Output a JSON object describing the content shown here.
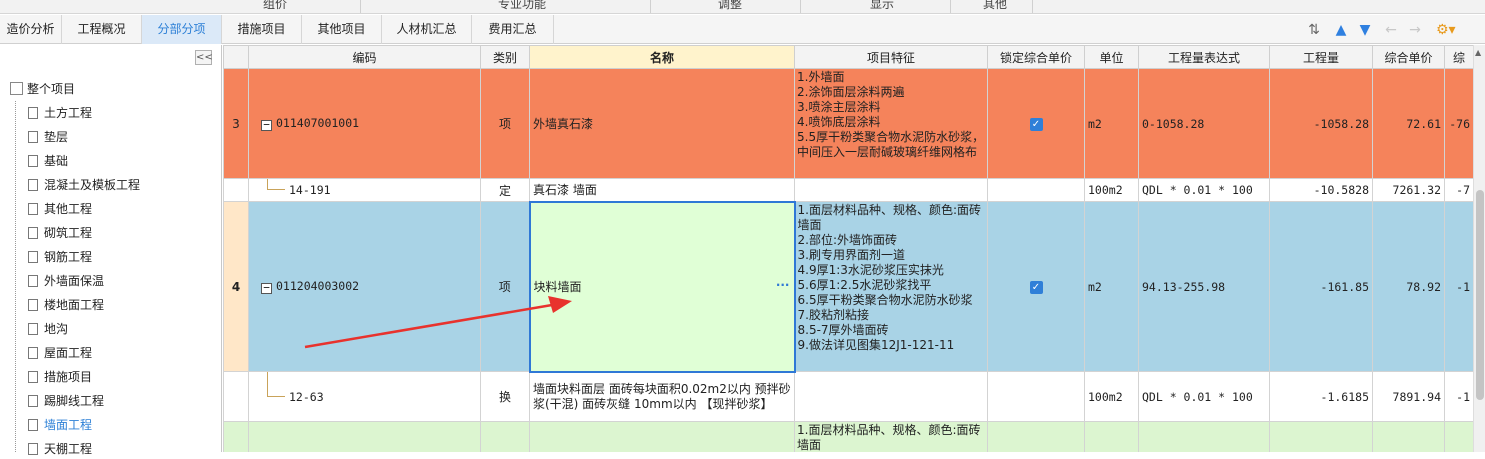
{
  "ribbon_groups": [
    "组价",
    "专业功能",
    "调整",
    "显示",
    "其他"
  ],
  "tabs": [
    {
      "label": "造价分析",
      "active": false
    },
    {
      "label": "工程概况",
      "active": false
    },
    {
      "label": "分部分项",
      "active": true
    },
    {
      "label": "措施项目",
      "active": false
    },
    {
      "label": "其他项目",
      "active": false
    },
    {
      "label": "人材机汇总",
      "active": false
    },
    {
      "label": "费用汇总",
      "active": false
    }
  ],
  "toolbar_icons": [
    "sort-icon",
    "move-up-icon",
    "move-down-icon",
    "back-icon",
    "forward-icon",
    "settings-icon"
  ],
  "sidebar": {
    "collapse_label": "<<",
    "root": "整个项目",
    "items": [
      "土方工程",
      "垫层",
      "基础",
      "混凝土及模板工程",
      "其他工程",
      "砌筑工程",
      "钢筋工程",
      "外墙面保温",
      "楼地面工程",
      "地沟",
      "屋面工程",
      "措施项目",
      "踢脚线工程",
      "墙面工程",
      "天棚工程"
    ],
    "selected": "墙面工程"
  },
  "grid": {
    "headers": [
      "",
      "编码",
      "类别",
      "名称",
      "项目特征",
      "锁定综合单价",
      "单位",
      "工程量表达式",
      "工程量",
      "综合单价",
      "综"
    ],
    "rows": [
      {
        "no": "3",
        "code": "011407001001",
        "type": "项",
        "name": "外墙真石漆",
        "features": "1.外墙面\n2.涂饰面层涂料两遍\n3.喷涂主层涂料\n4.喷饰底层涂料\n5.5厚干粉类聚合物水泥防水砂浆，中间压入一层耐碱玻璃纤维网格布",
        "locked": true,
        "unit": "m2",
        "expr": "0-1058.28",
        "qty": "-1058.28",
        "price": "72.61",
        "extra": "-76"
      },
      {
        "no": "",
        "code": "14-191",
        "type": "定",
        "name": "真石漆 墙面",
        "features": "",
        "locked": false,
        "unit": "100m2",
        "expr": "QDL * 0.01 * 100",
        "qty": "-10.5828",
        "price": "7261.32",
        "extra": "-7"
      },
      {
        "no": "4",
        "code": "011204003002",
        "type": "项",
        "name": "块料墙面",
        "features": "1.面层材料品种、规格、颜色:面砖墙面\n2.部位:外墙饰面砖\n3.刷专用界面剂一道\n4.9厚1:3水泥砂浆压实抹光\n5.6厚1:2.5水泥砂浆找平\n6.5厚干粉类聚合物水泥防水砂浆\n7.胶粘剂粘接\n8.5-7厚外墙面砖\n9.做法详见图集12J1-121-11",
        "locked": true,
        "unit": "m2",
        "expr": "94.13-255.98",
        "qty": "-161.85",
        "price": "78.92",
        "extra": "-1"
      },
      {
        "no": "",
        "code": "12-63",
        "type": "换",
        "name": "墙面块料面层 面砖每块面积0.02m2以内 预拌砂浆(干混) 面砖灰缝 10mm以内 【现拌砂浆】",
        "features": "",
        "locked": false,
        "unit": "100m2",
        "expr": "QDL * 0.01 * 100",
        "qty": "-1.6185",
        "price": "7891.94",
        "extra": "-1"
      },
      {
        "no": "",
        "code": "",
        "type": "",
        "name": "",
        "features": "1.面层材料品种、规格、颜色:面砖墙面",
        "locked": false,
        "unit": "",
        "expr": "",
        "qty": "",
        "price": "",
        "extra": ""
      }
    ],
    "more_icon": "ellipsis-icon"
  },
  "annotation_color": "#e8322d"
}
